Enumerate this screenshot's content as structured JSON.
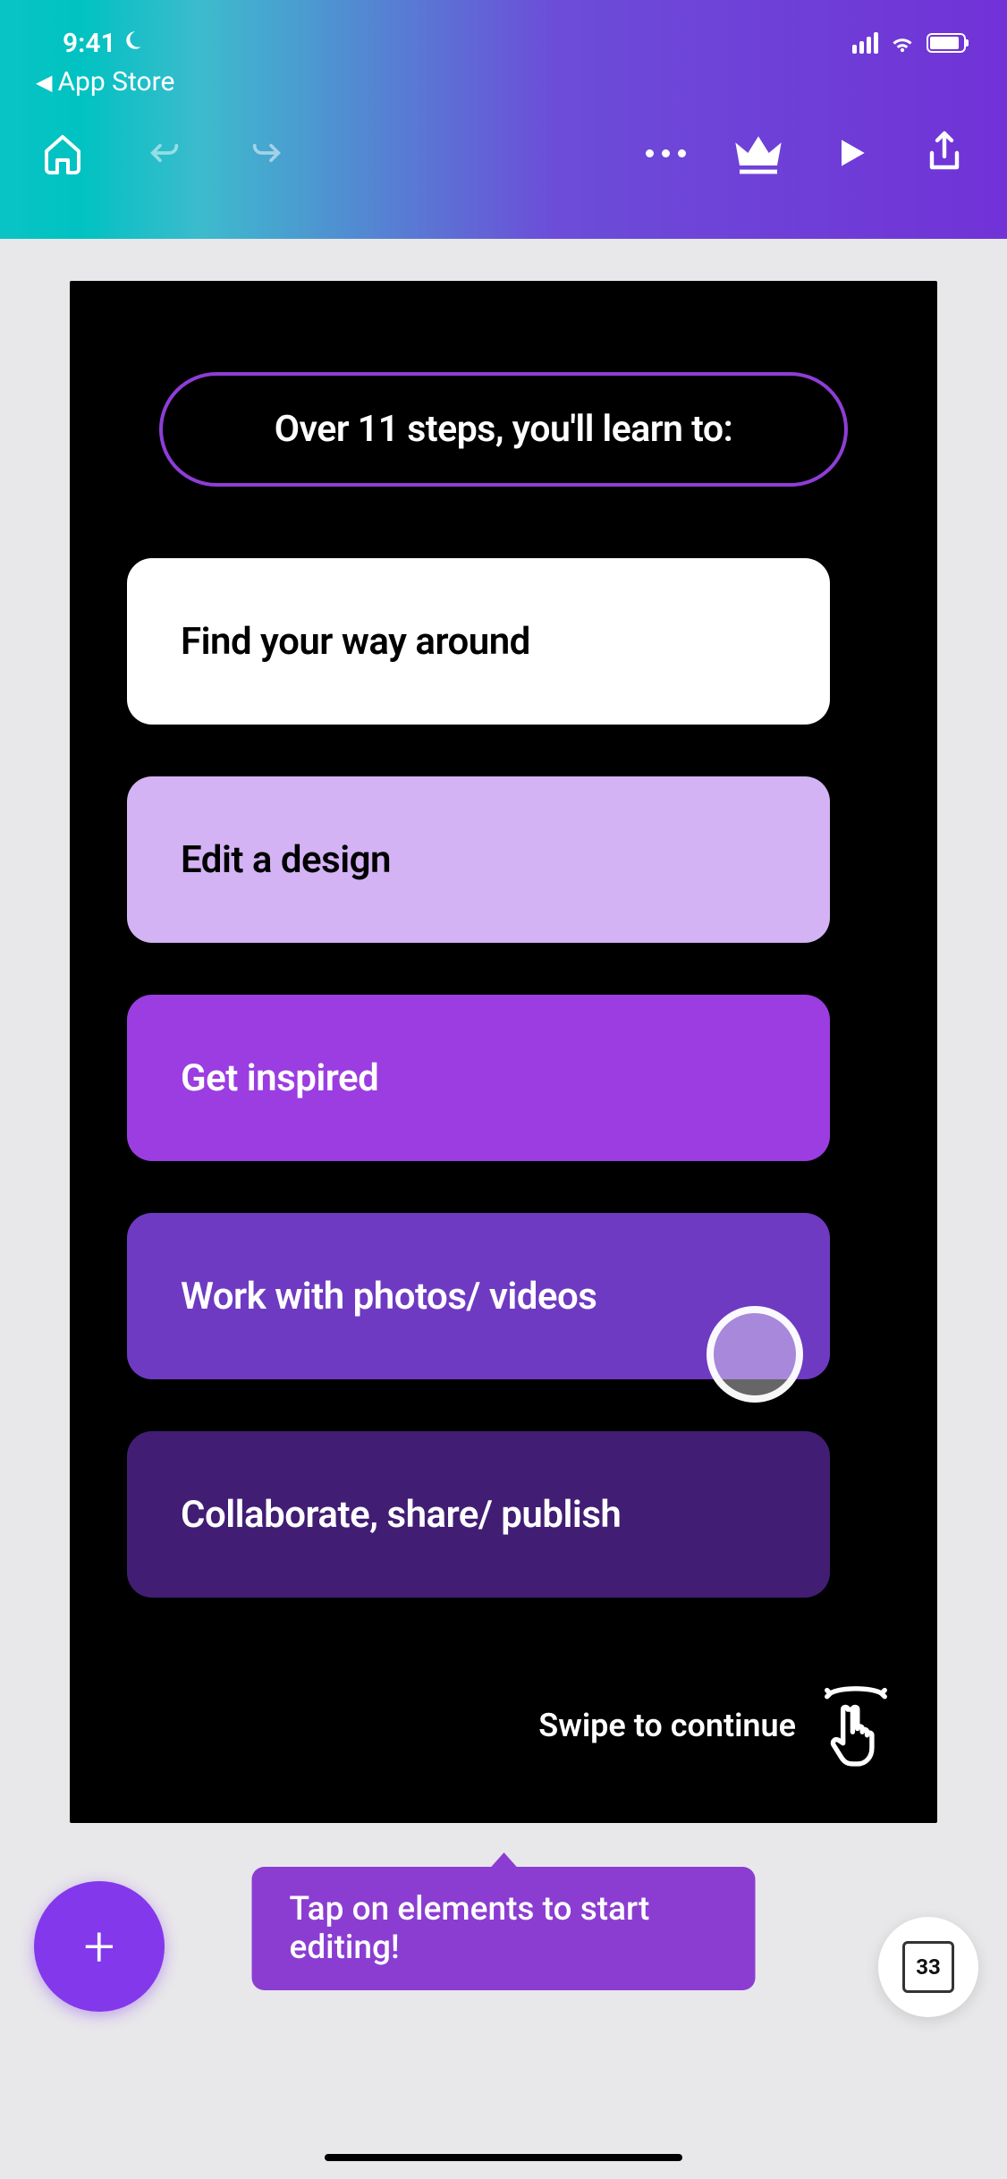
{
  "status": {
    "time": "9:41",
    "back_app_label": "App Store"
  },
  "canvas": {
    "title": "Over 11 steps, you'll learn to:",
    "items": [
      {
        "label": "Find your way around",
        "style": "white"
      },
      {
        "label": "Edit a design",
        "style": "lilac"
      },
      {
        "label": "Get inspired",
        "style": "purple"
      },
      {
        "label": "Work with photos/ videos",
        "style": "violet"
      },
      {
        "label": "Collaborate, share/ publish",
        "style": "dark"
      }
    ],
    "swipe_hint": "Swipe to continue"
  },
  "tooltip": "Tap on elements to start editing!",
  "page_count": "33"
}
